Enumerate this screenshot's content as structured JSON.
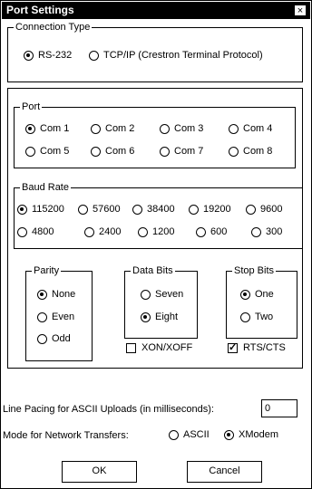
{
  "window": {
    "title": "Port Settings",
    "close_glyph": "×"
  },
  "connection": {
    "legend": "Connection Type",
    "options": [
      {
        "label": "RS-232",
        "selected": true
      },
      {
        "label": "TCP/IP (Crestron Terminal Protocol)",
        "selected": false
      }
    ]
  },
  "port": {
    "legend": "Port",
    "options": [
      {
        "label": "Com 1",
        "selected": true
      },
      {
        "label": "Com 2",
        "selected": false
      },
      {
        "label": "Com 3",
        "selected": false
      },
      {
        "label": "Com 4",
        "selected": false
      },
      {
        "label": "Com 5",
        "selected": false
      },
      {
        "label": "Com 6",
        "selected": false
      },
      {
        "label": "Com 7",
        "selected": false
      },
      {
        "label": "Com 8",
        "selected": false
      }
    ]
  },
  "baud": {
    "legend": "Baud Rate",
    "options": [
      {
        "label": "115200",
        "selected": true
      },
      {
        "label": "57600",
        "selected": false
      },
      {
        "label": "38400",
        "selected": false
      },
      {
        "label": "19200",
        "selected": false
      },
      {
        "label": "9600",
        "selected": false
      },
      {
        "label": "4800",
        "selected": false
      },
      {
        "label": "2400",
        "selected": false
      },
      {
        "label": "1200",
        "selected": false
      },
      {
        "label": "600",
        "selected": false
      },
      {
        "label": "300",
        "selected": false
      }
    ]
  },
  "parity": {
    "legend": "Parity",
    "options": [
      {
        "label": "None",
        "selected": true
      },
      {
        "label": "Even",
        "selected": false
      },
      {
        "label": "Odd",
        "selected": false
      }
    ]
  },
  "data_bits": {
    "legend": "Data Bits",
    "options": [
      {
        "label": "Seven",
        "selected": false
      },
      {
        "label": "Eight",
        "selected": true
      }
    ]
  },
  "stop_bits": {
    "legend": "Stop Bits",
    "options": [
      {
        "label": "One",
        "selected": true
      },
      {
        "label": "Two",
        "selected": false
      }
    ]
  },
  "flow": {
    "xon": {
      "label": "XON/XOFF",
      "checked": false
    },
    "rts": {
      "label": "RTS/CTS",
      "checked": true
    }
  },
  "pacing": {
    "label": "Line Pacing for ASCII Uploads (in milliseconds):",
    "value": "0"
  },
  "mode": {
    "label": "Mode for Network Transfers:",
    "options": [
      {
        "label": "ASCII",
        "selected": false
      },
      {
        "label": "XModem",
        "selected": true
      }
    ]
  },
  "buttons": {
    "ok": "OK",
    "cancel": "Cancel"
  }
}
